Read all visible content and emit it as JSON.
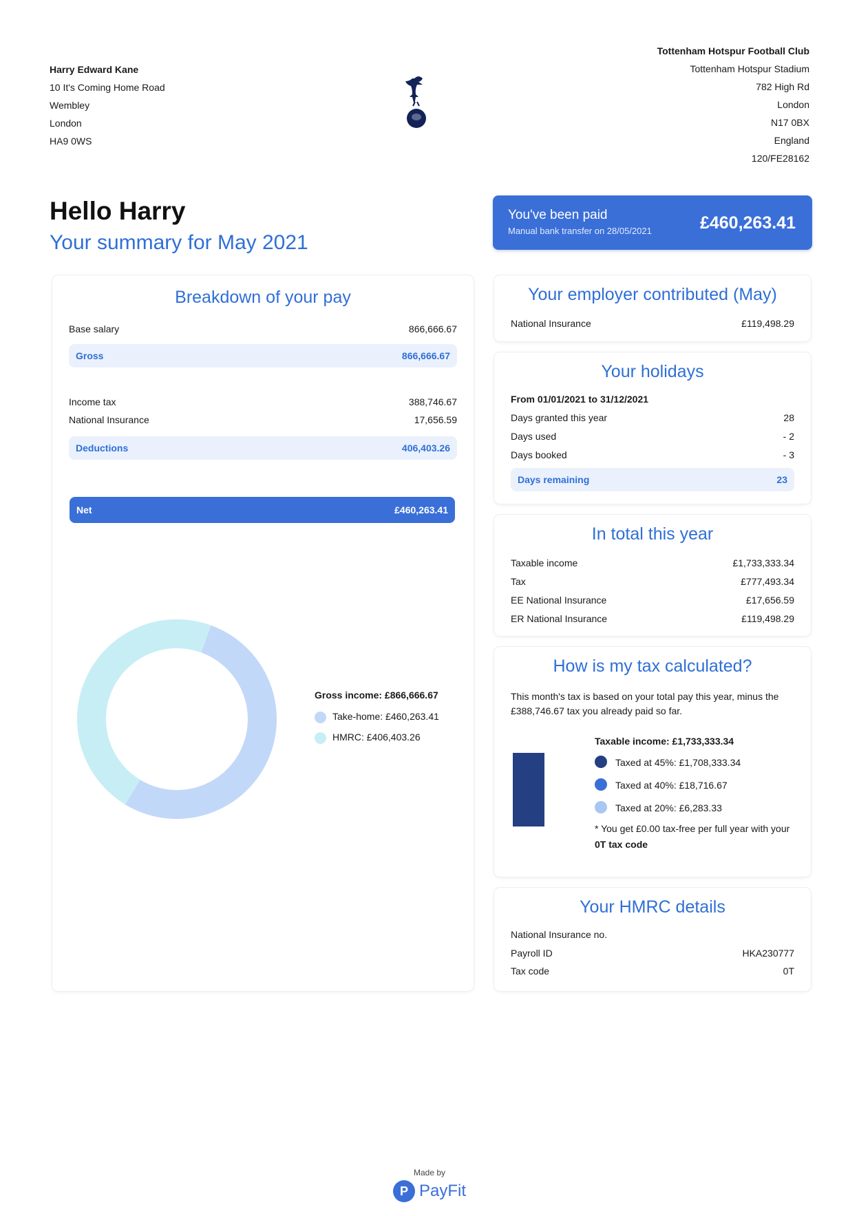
{
  "employee": {
    "name": "Harry Edward Kane",
    "address": [
      "10 It's Coming Home Road",
      "Wembley",
      "London",
      "HA9 0WS"
    ]
  },
  "employer": {
    "name": "Tottenham Hotspur Football Club",
    "address": [
      "Tottenham Hotspur Stadium",
      "782 High Rd",
      "London",
      "N17 0BX",
      "England",
      "120/FE28162"
    ]
  },
  "greeting": "Hello Harry",
  "summary_title": "Your summary for May 2021",
  "paid": {
    "title": "You've been paid",
    "subtitle": "Manual bank transfer on 28/05/2021",
    "amount": "£460,263.41"
  },
  "breakdown": {
    "title": "Breakdown of your pay",
    "base_salary_label": "Base salary",
    "base_salary_value": "866,666.67",
    "gross_label": "Gross",
    "gross_value": "866,666.67",
    "income_tax_label": "Income tax",
    "income_tax_value": "388,746.67",
    "ni_label": "National Insurance",
    "ni_value": "17,656.59",
    "deductions_label": "Deductions",
    "deductions_value": "406,403.26",
    "net_label": "Net",
    "net_value": "£460,263.41"
  },
  "pay_chart": {
    "gross_income": "Gross income: £866,666.67",
    "take_home": "Take-home: £460,263.41",
    "hmrc": "HMRC: £406,403.26"
  },
  "chart_data": {
    "type": "pie",
    "title": "Gross income: £866,666.67",
    "series": [
      {
        "name": "Take-home",
        "value": 460263.41,
        "color": "#c2d8f8"
      },
      {
        "name": "HMRC",
        "value": 406403.26,
        "color": "#c7eef4"
      }
    ]
  },
  "employer_contribution": {
    "title": "Your employer contributed (May)",
    "ni_label": "National Insurance",
    "ni_value": "£119,498.29"
  },
  "holidays": {
    "title": "Your holidays",
    "period": "From 01/01/2021 to 31/12/2021",
    "granted_label": "Days granted this year",
    "granted_value": "28",
    "used_label": "Days used",
    "used_value": "- 2",
    "booked_label": "Days booked",
    "booked_value": "- 3",
    "remaining_label": "Days remaining",
    "remaining_value": "23"
  },
  "year_total": {
    "title": "In total this year",
    "rows": [
      {
        "label": "Taxable income",
        "value": "£1,733,333.34"
      },
      {
        "label": "Tax",
        "value": "£777,493.34"
      },
      {
        "label": "EE National Insurance",
        "value": "£17,656.59"
      },
      {
        "label": "ER National Insurance",
        "value": "£119,498.29"
      }
    ]
  },
  "tax_calc": {
    "title": "How is my tax calculated?",
    "text": "This month's tax is based on your total pay this year, minus the £388,746.67 tax you already paid so far.",
    "taxable_income": "Taxable income: £1,733,333.34",
    "band_45": "Taxed at 45%: £1,708,333.34",
    "band_40": "Taxed at 40%: £18,716.67",
    "band_20": "Taxed at 20%: £6,283.33",
    "note_prefix": "* You get £0.00 tax-free per full year with your ",
    "note_code": "0T tax code",
    "colors": {
      "band_45": "#243f82",
      "band_40": "#3a6fd8",
      "band_20": "#a9c7f3"
    }
  },
  "hmrc_details": {
    "title": "Your HMRC details",
    "ni_no_label": "National Insurance no.",
    "ni_no_value": "",
    "payroll_id_label": "Payroll ID",
    "payroll_id_value": "HKA230777",
    "tax_code_label": "Tax code",
    "tax_code_value": "0T"
  },
  "footer": {
    "made_by": "Made by",
    "brand": "PayFit",
    "logo_letter": "P"
  }
}
